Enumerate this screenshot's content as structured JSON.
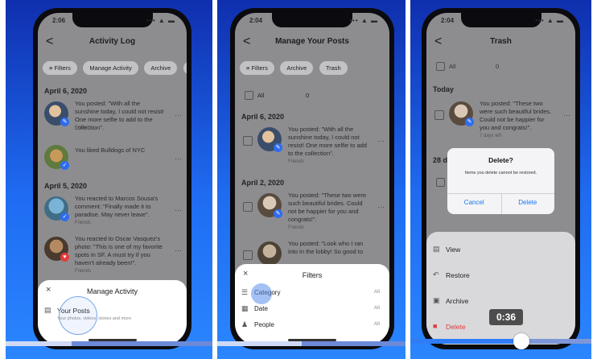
{
  "colors": {
    "brand": "#1877f2",
    "gray_overlay": "#8d8d90",
    "delete_red": "#e23b3b",
    "seek_blue": "#2f7df6"
  },
  "panel1": {
    "time": "2:06",
    "signal": "••• ▲ ▬",
    "title": "Activity Log",
    "back": "<",
    "chips": [
      "Filters",
      "Manage Activity",
      "Archive",
      "T"
    ],
    "dates": [
      "April 6, 2020",
      "April 5, 2020"
    ],
    "items": [
      {
        "text": "You posted: \"With all the sunshine today, I could not resist! One more selfie to add to the collection\".",
        "sub": "Friends"
      },
      {
        "text": "You liked Bulldogs of NYC",
        "sub": ""
      },
      {
        "text": "You reacted to Marcos Sousa's comment: \"Finally made it to paradise. May never leave\".",
        "sub": "Friends"
      },
      {
        "text": "You reacted to Oscar Vasquez's photo: \"This is one of my favorite spots in SF. A must try if you haven't already been!\".",
        "sub": "Friends"
      }
    ],
    "sheet": {
      "title": "Manage Activity",
      "close": "×",
      "option": "Your Posts",
      "option_sub": "Your photos, videos, stories and more"
    }
  },
  "panel2": {
    "time": "2:04",
    "title": "Manage Your Posts",
    "back": "<",
    "chips": [
      "Filters",
      "Archive",
      "Trash"
    ],
    "all_label": "All",
    "all_count": "0",
    "dates": [
      "April 6, 2020",
      "April 2, 2020"
    ],
    "items": [
      {
        "text": "You posted: \"With all the sunshine today, I could not resist! One more selfie to add to the collection\".",
        "sub": "Friends"
      },
      {
        "text": "You posted: \"These two were such beautiful brides. Could not be happier for you and congrats!\".",
        "sub": "Friends"
      },
      {
        "text": "You posted: \"Look who I ran into in the lobby! So good to",
        "sub": ""
      }
    ],
    "sheet": {
      "title": "Filters",
      "close": "×",
      "rows": [
        {
          "label": "Category",
          "value": "All"
        },
        {
          "label": "Date",
          "value": "All"
        },
        {
          "label": "People",
          "value": "All"
        }
      ]
    }
  },
  "panel3": {
    "time": "2:04",
    "title": "Trash",
    "back": "<",
    "all_label": "All",
    "all_count": "0",
    "today": "Today",
    "date2": "28 d",
    "item": {
      "text": "You posted: \"These two were such beautiful brides. Could not be happier for you and congrats!\".",
      "sub": "7 days left"
    },
    "dialog": {
      "title": "Delete?",
      "message": "Items you delete cannot be restored.",
      "cancel": "Cancel",
      "delete": "Delete"
    },
    "menu": [
      {
        "label": "View"
      },
      {
        "label": "Restore"
      },
      {
        "label": "Archive"
      },
      {
        "label": "Delete"
      }
    ],
    "video_time": "0:36"
  }
}
